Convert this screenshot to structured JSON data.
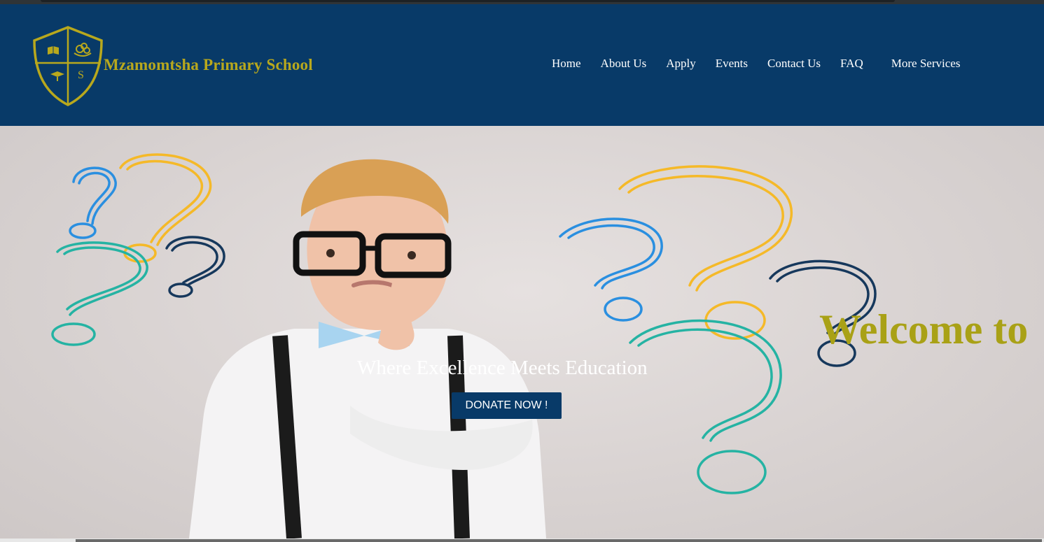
{
  "header": {
    "school_name": "Mzamomtsha Primary School",
    "crest_letter": "S"
  },
  "nav": {
    "items": [
      {
        "label": "Home"
      },
      {
        "label": "About Us"
      },
      {
        "label": "Apply"
      },
      {
        "label": "Events"
      },
      {
        "label": "Contact Us"
      },
      {
        "label": "FAQ"
      }
    ],
    "more_label": "More Services"
  },
  "hero": {
    "welcome_text": "Welcome to",
    "tagline": "Where Excellence Meets Education",
    "donate_label": "DONATE NOW !"
  },
  "colors": {
    "header_bg": "#083a68",
    "brand_gold": "#b8a81d",
    "welcome_olive": "#a9a116",
    "button_bg": "#083a68",
    "q_blue": "#2a8fe0",
    "q_yellow": "#f5b928",
    "q_navy": "#16385c",
    "q_teal": "#25b3a3"
  },
  "icons": {
    "crest": "shield-crest-icon"
  }
}
